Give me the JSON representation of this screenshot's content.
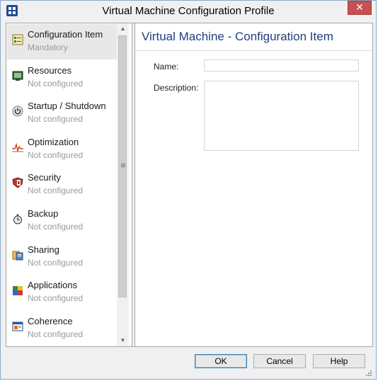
{
  "window": {
    "title": "Virtual Machine Configuration Profile",
    "close_glyph": "✕"
  },
  "nav": {
    "items": [
      {
        "label": "Configuration Item",
        "status": "Mandatory",
        "icon": "config-item-icon"
      },
      {
        "label": "Resources",
        "status": "Not configured",
        "icon": "resources-icon"
      },
      {
        "label": "Startup / Shutdown",
        "status": "Not configured",
        "icon": "power-icon"
      },
      {
        "label": "Optimization",
        "status": "Not configured",
        "icon": "optimization-icon"
      },
      {
        "label": "Security",
        "status": "Not configured",
        "icon": "security-icon"
      },
      {
        "label": "Backup",
        "status": "Not configured",
        "icon": "backup-icon"
      },
      {
        "label": "Sharing",
        "status": "Not configured",
        "icon": "sharing-icon"
      },
      {
        "label": "Applications",
        "status": "Not configured",
        "icon": "applications-icon"
      },
      {
        "label": "Coherence",
        "status": "Not configured",
        "icon": "coherence-icon"
      }
    ],
    "selected_index": 0
  },
  "content": {
    "title": "Virtual Machine - Configuration Item",
    "name_label": "Name:",
    "name_value": "",
    "description_label": "Description:",
    "description_value": ""
  },
  "buttons": {
    "ok": "OK",
    "cancel": "Cancel",
    "help": "Help"
  },
  "colors": {
    "accent": "#1f3f80",
    "close": "#c75050",
    "muted": "#9a9a9a"
  }
}
